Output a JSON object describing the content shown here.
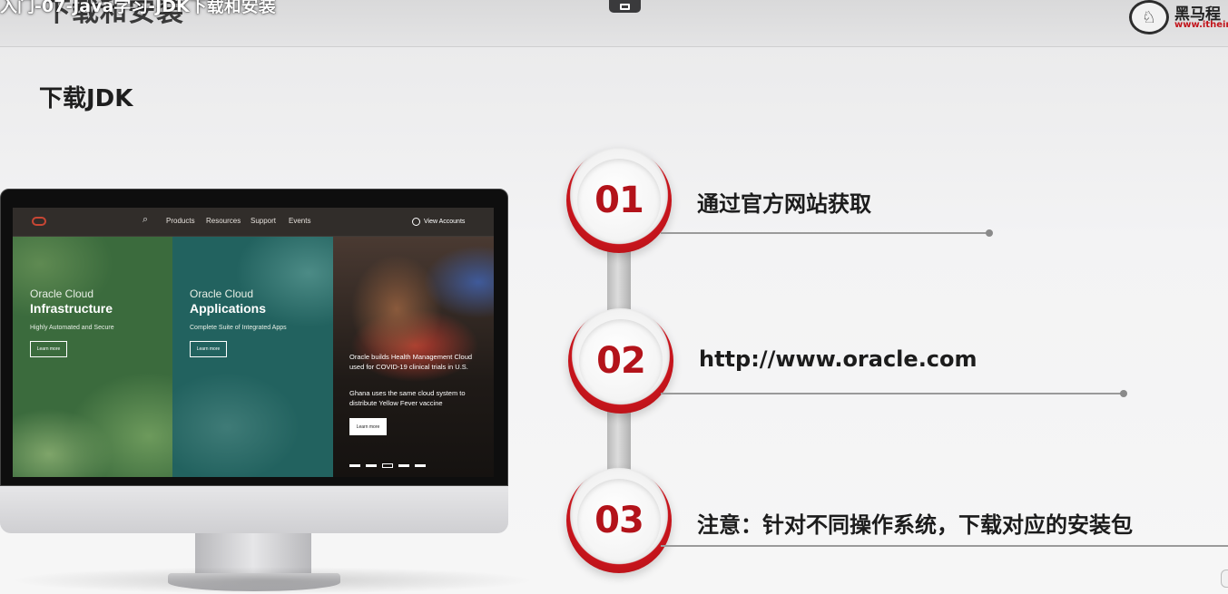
{
  "header": {
    "video_title": "入门-07-Java学习-JDK下载和安装",
    "slide_title": "下载和安装",
    "logo": {
      "name": "黑马程",
      "url": "www.itheim"
    }
  },
  "slide": {
    "subheading": "下载JDK"
  },
  "monitor": {
    "nav": {
      "links": [
        "Products",
        "Resources",
        "Support",
        "Events"
      ],
      "account_label": "View Accounts"
    },
    "panels": [
      {
        "sub": "Oracle Cloud",
        "title": "Infrastructure",
        "desc": "Highly Automated and Secure",
        "button": "Learn more"
      },
      {
        "sub": "Oracle Cloud",
        "title": "Applications",
        "desc": "Complete Suite of Integrated Apps",
        "button": "Learn more"
      }
    ],
    "news": {
      "headline": "Oracle builds Health Management Cloud used for COVID-19 clinical trials in U.S.",
      "subline": "Ghana uses the same cloud system to distribute Yellow Fever vaccine",
      "button": "Learn more"
    }
  },
  "steps": [
    {
      "number": "01",
      "text": "通过官方网站获取"
    },
    {
      "number": "02",
      "text": "http://www.oracle.com"
    },
    {
      "number": "03",
      "text": "注意：针对不同操作系统，下载对应的安装包"
    }
  ],
  "colors": {
    "accent_red": "#b3131a",
    "oracle_red": "#c74634"
  }
}
